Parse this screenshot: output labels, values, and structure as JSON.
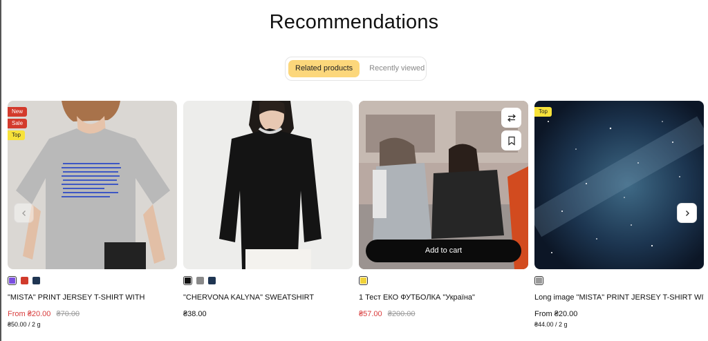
{
  "title": "Recommendations",
  "tabs": [
    {
      "label": "Related products",
      "active": true
    },
    {
      "label": "Recently viewed",
      "active": false
    }
  ],
  "colors": {
    "accent_tab": "#fcd77b",
    "sale_red": "#d83a3a",
    "badge_red": "#d33a2c",
    "badge_top": "#f7e23a"
  },
  "products": [
    {
      "badges": [
        "New",
        "Sale",
        "Top"
      ],
      "swatches": [
        "#7b4fe0",
        "#d13b2c",
        "#1f3552"
      ],
      "name": "\"MISTA\" PRINT JERSEY T-SHIRT WITH",
      "price_prefix": "From",
      "price": "₴20.00",
      "old_price": "₴70.00",
      "unit_price": "₴50.00 / 2 g"
    },
    {
      "badges": [],
      "swatches": [
        "#111111",
        "#8a8a8a",
        "#1f3552"
      ],
      "name": "\"CHERVONA KALYNA\" SWEATSHIRT",
      "price": "₴38.00"
    },
    {
      "badges": [],
      "swatches": [
        "#f0d23a"
      ],
      "name": "1 Тест ЕКО ФУТБОЛКА \"Україна\"",
      "price": "₴57.00",
      "old_price": "₴200.00",
      "add_to_cart": "Add to cart"
    },
    {
      "badges": [
        "Top"
      ],
      "swatches": [
        "#9a9a9a"
      ],
      "name": "Long image \"MISTA\" PRINT JERSEY T-SHIRT WITH",
      "price_prefix": "From",
      "price": "₴20.00",
      "unit_price": "₴44.00 / 2 g"
    }
  ],
  "icons": {
    "prev": "chevron-left-icon",
    "next": "chevron-right-icon",
    "compare": "compare-arrows-icon",
    "wishlist": "bookmark-icon"
  }
}
